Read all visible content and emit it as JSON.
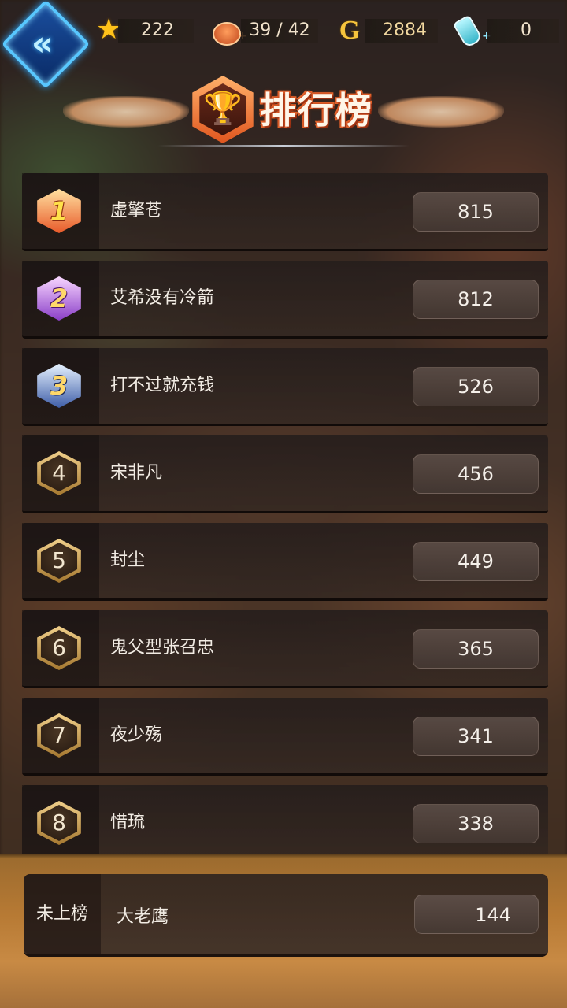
{
  "topbar": {
    "back_icon": "double-chevron-left-icon",
    "stars": "222",
    "stamina": "39 / 42",
    "gold": "2884",
    "potions": "0"
  },
  "title": "排行榜",
  "leaderboard": [
    {
      "rank": "1",
      "name": "虚擎苍",
      "score": "815"
    },
    {
      "rank": "2",
      "name": "艾希没有冷箭",
      "score": "812"
    },
    {
      "rank": "3",
      "name": "打不过就充钱",
      "score": "526"
    },
    {
      "rank": "4",
      "name": "宋非凡",
      "score": "456"
    },
    {
      "rank": "5",
      "name": "封尘",
      "score": "449"
    },
    {
      "rank": "6",
      "name": "鬼父型张召忠",
      "score": "365"
    },
    {
      "rank": "7",
      "name": "夜少殇",
      "score": "341"
    },
    {
      "rank": "8",
      "name": "惜琉",
      "score": "338"
    }
  ],
  "me": {
    "rank_label": "未上榜",
    "name": "大老鹰",
    "score": "144"
  },
  "colors": {
    "accent_blue": "#58c7ff",
    "gold": "#f6c43d",
    "title_orange": "#e0561f"
  }
}
